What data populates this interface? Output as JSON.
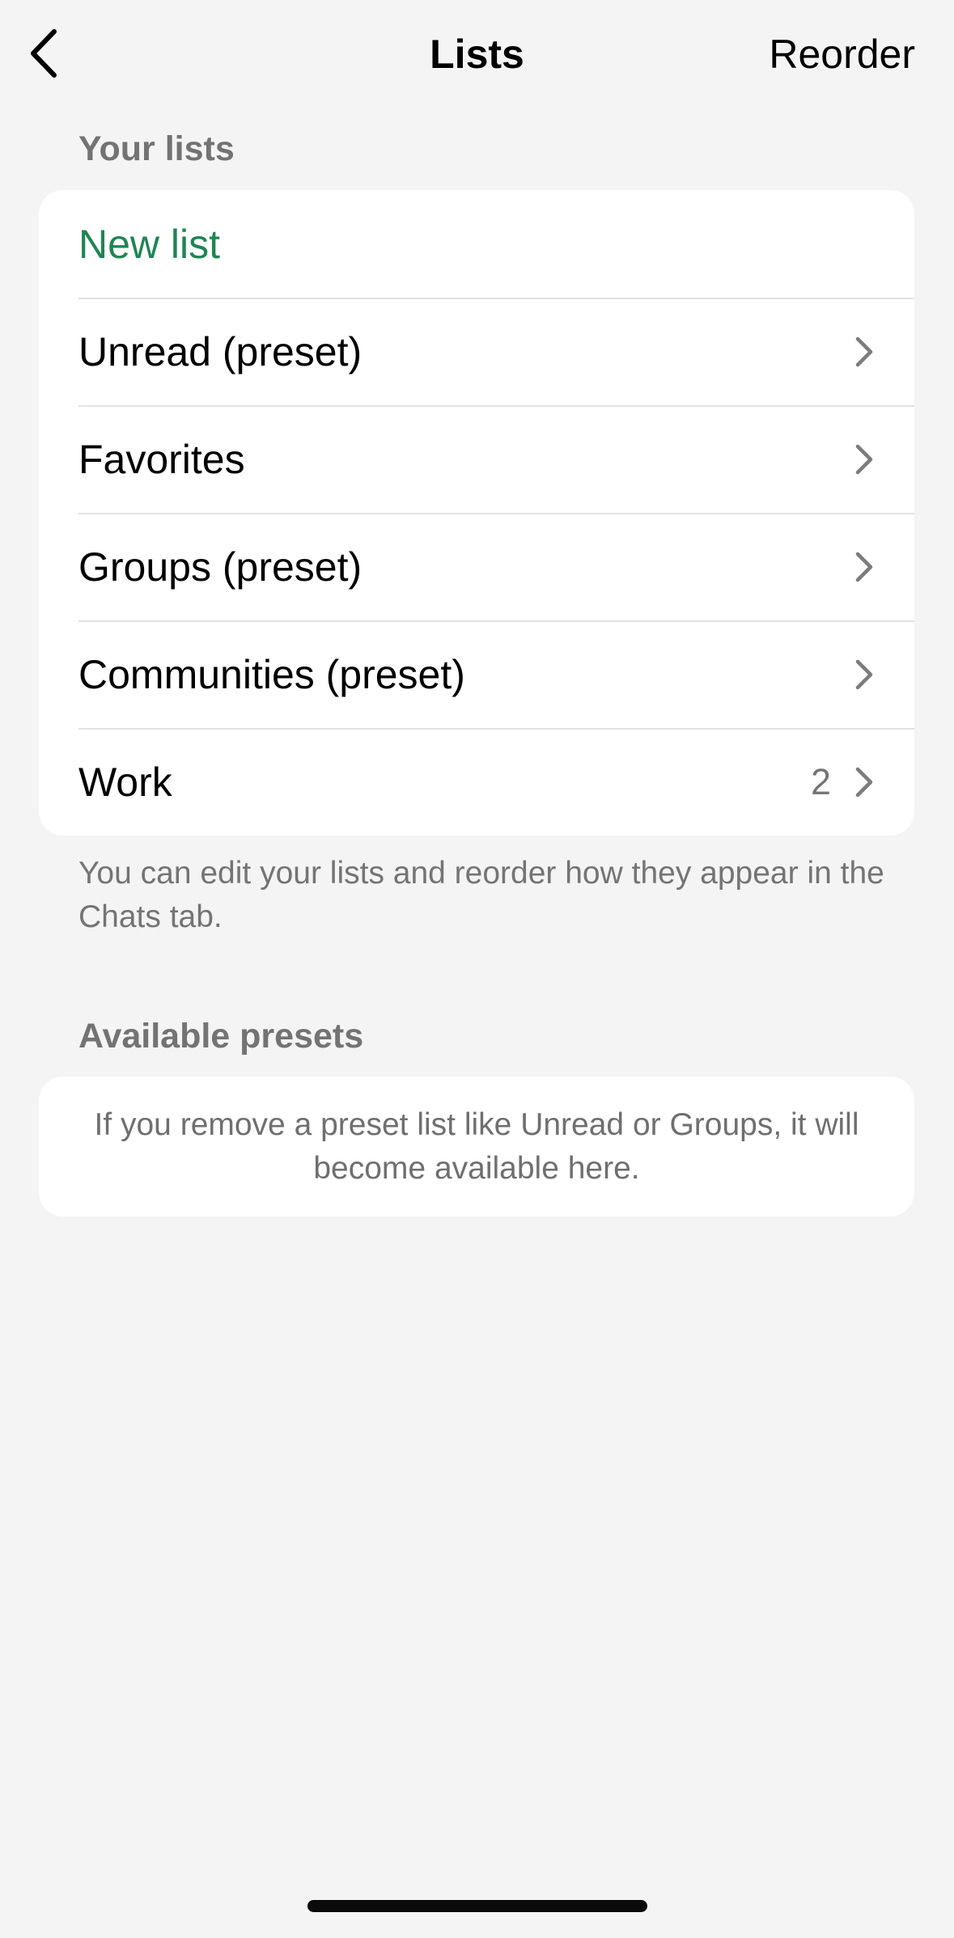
{
  "nav": {
    "title": "Lists",
    "reorder_label": "Reorder"
  },
  "your_lists": {
    "header": "Your lists",
    "new_list_label": "New list",
    "items": [
      {
        "label": "Unread (preset)",
        "count": ""
      },
      {
        "label": "Favorites",
        "count": ""
      },
      {
        "label": "Groups (preset)",
        "count": ""
      },
      {
        "label": "Communities (preset)",
        "count": ""
      },
      {
        "label": "Work",
        "count": "2"
      }
    ],
    "footer": "You can edit your lists and reorder how they appear in the Chats tab."
  },
  "available_presets": {
    "header": "Available presets",
    "note": "If you remove a preset list like Unread or Groups, it will become available here."
  },
  "colors": {
    "accent": "#1e8553",
    "background": "#f4f4f4",
    "card": "#ffffff",
    "secondary_text": "#757575"
  }
}
